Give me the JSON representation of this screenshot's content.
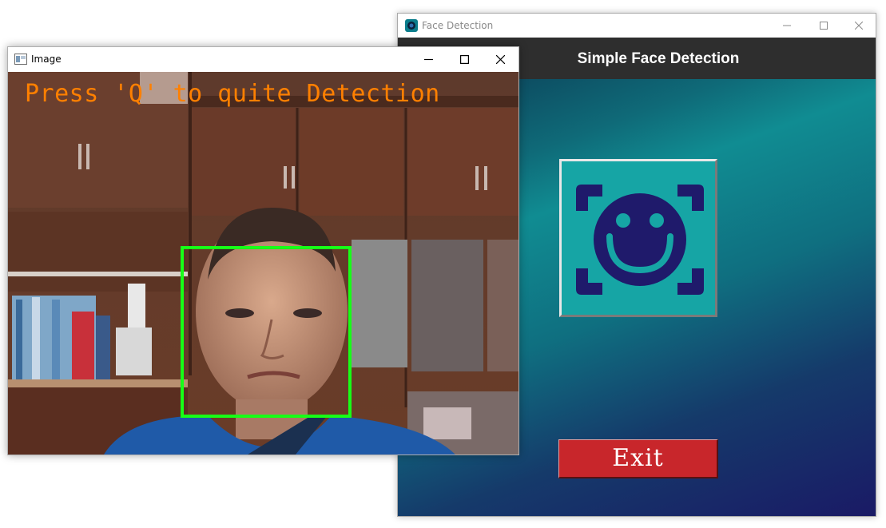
{
  "face_detection_window": {
    "title": "Face Detection",
    "heading": "Simple Face Detection",
    "face_button": {
      "icon": "smiley-face-scan-icon",
      "bg_color": "#16a5a5",
      "icon_color": "#1f1a6b"
    },
    "exit_button": {
      "label": "Exit",
      "bg_color": "#c8262b"
    },
    "controls": [
      "minimize",
      "maximize",
      "close"
    ]
  },
  "image_window": {
    "title": "Image",
    "overlay_text": "Press 'Q' to quite Detection",
    "overlay_color": "#ff8000",
    "detection_box_color": "#17ff17",
    "controls": [
      "minimize",
      "maximize",
      "close"
    ]
  }
}
